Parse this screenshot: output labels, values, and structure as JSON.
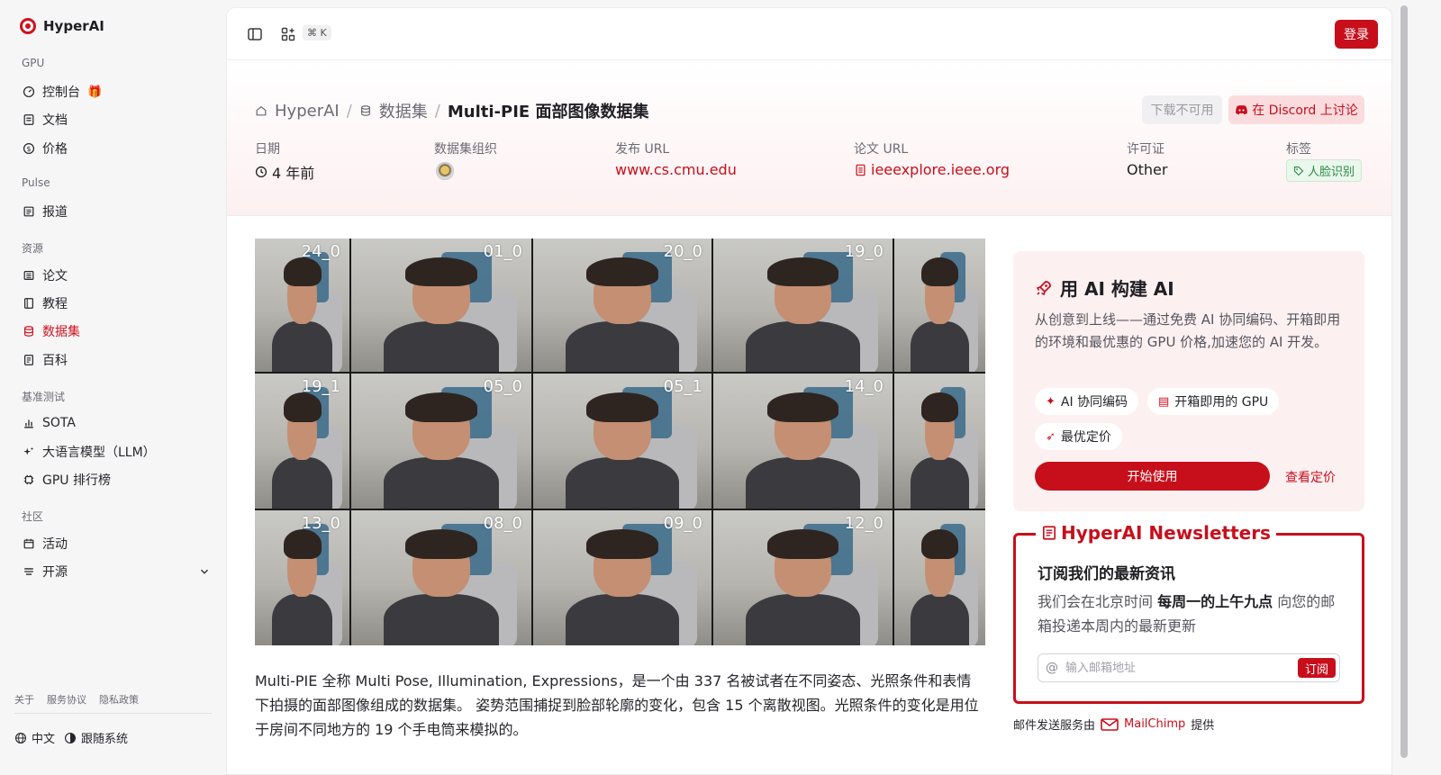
{
  "brand": {
    "name": "HyperAI"
  },
  "sidebar": {
    "sections": [
      {
        "title": "GPU",
        "items": [
          {
            "label": "控制台",
            "icon": "dashboard-icon"
          },
          {
            "label": "文档",
            "icon": "document-icon"
          },
          {
            "label": "价格",
            "icon": "dollar-icon"
          }
        ]
      },
      {
        "title": "Pulse",
        "items": [
          {
            "label": "报道",
            "icon": "news-icon"
          }
        ]
      },
      {
        "title": "资源",
        "items": [
          {
            "label": "论文",
            "icon": "paper-icon"
          },
          {
            "label": "教程",
            "icon": "book-icon"
          },
          {
            "label": "数据集",
            "icon": "database-icon"
          },
          {
            "label": "百科",
            "icon": "wiki-icon"
          }
        ]
      },
      {
        "title": "基准测试",
        "items": [
          {
            "label": "SOTA",
            "icon": "chart-icon"
          },
          {
            "label": "大语言模型（LLM）",
            "icon": "sparkle-icon"
          },
          {
            "label": "GPU 排行榜",
            "icon": "chip-icon"
          }
        ]
      },
      {
        "title": "社区",
        "items": [
          {
            "label": "活动",
            "icon": "calendar-icon"
          },
          {
            "label": "开源",
            "icon": "list-icon"
          }
        ]
      }
    ],
    "footer_links": [
      "关于",
      "服务协议",
      "隐私政策"
    ],
    "language": "中文",
    "theme": "跟随系统"
  },
  "topbar": {
    "shortcut": "⌘ K",
    "login_label": "登录"
  },
  "breadcrumb": {
    "home": "HyperAI",
    "section": "数据集",
    "current": "Multi-PIE 面部图像数据集"
  },
  "header_buttons": {
    "download": "下载不可用",
    "discord": "在 Discord 上讨论"
  },
  "meta": {
    "date_label": "日期",
    "date_value": "4 年前",
    "org_label": "数据集组织",
    "release_url_label": "发布 URL",
    "release_url": "www.cs.cmu.edu",
    "paper_url_label": "论文 URL",
    "paper_url": "ieeexplore.ieee.org",
    "license_label": "许可证",
    "license_value": "Other",
    "tags_label": "标签",
    "tag": "人脸识别"
  },
  "image_labels": [
    "24_0",
    "01_0",
    "20_0",
    "19_0",
    "",
    "19_1",
    "05_0",
    "05_1",
    "14_0",
    "",
    "13_0",
    "08_0",
    "09_0",
    "12_0",
    ""
  ],
  "description": "Multi-PIE 全称 Multi Pose, Illumination, Expressions，是一个由 337 名被试者在不同姿态、光照条件和表情下拍摄的面部图像组成的数据集。 姿势范围捕捉到脸部轮廓的变化，包含 15 个离散视图。光照条件的变化是用位于房间不同地方的 19 个手电筒来模拟的。",
  "promo": {
    "title": "用 AI 构建 AI",
    "description": "从创意到上线——通过免费 AI 协同编码、开箱即用的环境和最优惠的 GPU 价格,加速您的 AI 开发。",
    "chips": [
      "AI 协同编码",
      "开箱即用的 GPU",
      "最优定价"
    ],
    "start_label": "开始使用",
    "pricing_label": "查看定价"
  },
  "newsletter": {
    "legend": "HyperAI Newsletters",
    "heading": "订阅我们的最新资讯",
    "text_before": "我们会在北京时间 ",
    "text_bold": "每周一的上午九点",
    "text_after": " 向您的邮箱投递本周内的最新更新",
    "email_placeholder": "输入邮箱地址",
    "subscribe_label": "订阅",
    "powered_before": "邮件发送服务由",
    "powered_brand": "MailChimp",
    "powered_after": "提供"
  },
  "colors": {
    "accent": "#c70f1c",
    "tag_green": "#2c8a45"
  }
}
